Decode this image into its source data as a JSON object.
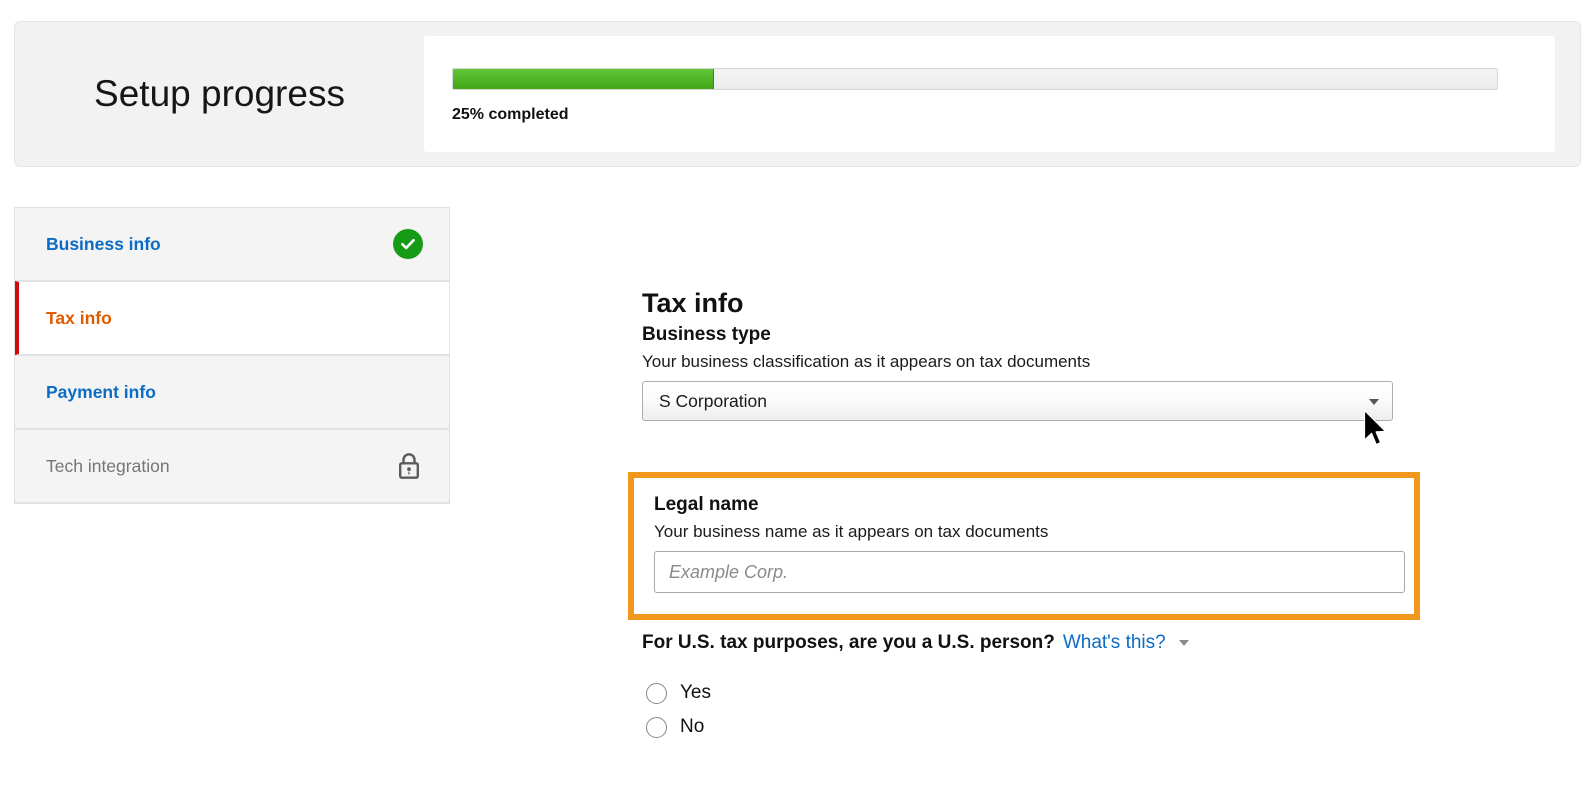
{
  "header": {
    "title": "Setup progress",
    "progress_percent": 25,
    "progress_caption": "25% completed",
    "fill_color": "#4CAF2F",
    "track_color": "#ececec"
  },
  "sidebar": {
    "items": [
      {
        "label": "Business info",
        "state": "complete",
        "icon": "check-circle-icon",
        "color": "#0c6cc4"
      },
      {
        "label": "Tax info",
        "state": "active",
        "icon": "",
        "color": "#e05a00"
      },
      {
        "label": "Payment info",
        "state": "available",
        "icon": "",
        "color": "#0c6cc4"
      },
      {
        "label": "Tech integration",
        "state": "locked",
        "icon": "lock-icon",
        "color": "#767676"
      }
    ]
  },
  "main": {
    "section_title": "Tax info",
    "business_type": {
      "label": "Business type",
      "description": "Your business classification as it appears on tax documents",
      "selected": "S Corporation",
      "caret_icon": "chevron-down-icon"
    },
    "legal_name": {
      "label": "Legal name",
      "description": "Your business name as it appears on tax documents",
      "value": "",
      "placeholder": "Example Corp.",
      "highlight_color": "#f0971c"
    },
    "us_person": {
      "question": "For U.S. tax purposes, are you a U.S. person?",
      "help_link": "What's this?",
      "help_caret_icon": "chevron-down-icon",
      "options": [
        {
          "label": "Yes",
          "selected": false
        },
        {
          "label": "No",
          "selected": false
        }
      ]
    }
  },
  "cursor": {
    "icon": "mouse-pointer-icon"
  }
}
